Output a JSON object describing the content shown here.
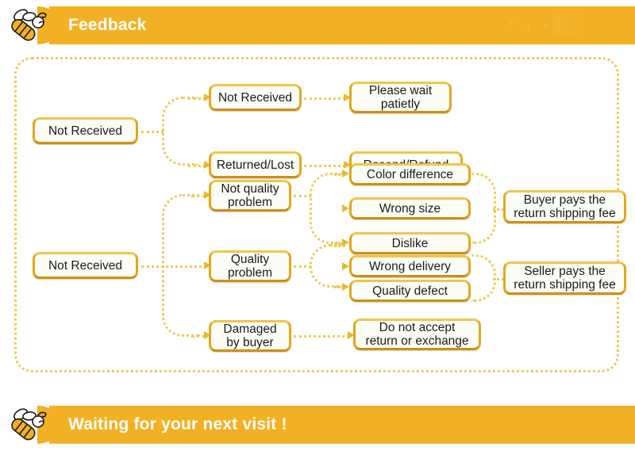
{
  "header": {
    "title": "Feedback",
    "icon": "bee-icon",
    "accent_color": "#f2b024",
    "title_color": "#ffffff"
  },
  "footer": {
    "title": "Waiting for your next visit !",
    "icon": "bee-icon",
    "accent_color": "#f2b024",
    "title_color": "#ffffff"
  },
  "theme": {
    "node_border": "#e3a71b",
    "node_fill": "#fdfdf7",
    "connector": "#eccb5a",
    "arrow": "#e8b932",
    "text": "#1a1a1a"
  },
  "flowchart": {
    "type": "diagram",
    "nodes": {
      "root_not_received_top": "Not Received",
      "root_not_received_bottom": "Not Received",
      "not_received_2": "Not Received",
      "returned_lost": "Returned/Lost",
      "please_wait": "Please wait\npatietly",
      "resend_refund": "Resend/Refund",
      "not_quality_problem": "Not quality\nproblem",
      "quality_problem": "Quality\nproblem",
      "damaged_by_buyer": "Damaged\nby buyer",
      "color_difference": "Color difference",
      "wrong_size": "Wrong size",
      "dislike": "Dislike",
      "wrong_delivery": "Wrong delivery",
      "quality_defect": "Quality defect",
      "buyer_pays": "Buyer pays the\nreturn shipping fee",
      "seller_pays": "Seller pays the\nreturn shipping fee",
      "do_not_accept": "Do not accept\nreturn or exchange"
    },
    "edges": [
      {
        "from": "root_not_received_top",
        "to": "not_received_2"
      },
      {
        "from": "root_not_received_top",
        "to": "returned_lost"
      },
      {
        "from": "not_received_2",
        "to": "please_wait"
      },
      {
        "from": "returned_lost",
        "to": "resend_refund"
      },
      {
        "from": "root_not_received_bottom",
        "to": "not_quality_problem"
      },
      {
        "from": "root_not_received_bottom",
        "to": "quality_problem"
      },
      {
        "from": "root_not_received_bottom",
        "to": "damaged_by_buyer"
      },
      {
        "from": "not_quality_problem",
        "to": "color_difference"
      },
      {
        "from": "not_quality_problem",
        "to": "wrong_size"
      },
      {
        "from": "not_quality_problem",
        "to": "dislike"
      },
      {
        "from": "quality_problem",
        "to": "wrong_delivery"
      },
      {
        "from": "quality_problem",
        "to": "quality_defect"
      },
      {
        "from": "color_difference",
        "to": "buyer_pays"
      },
      {
        "from": "wrong_size",
        "to": "buyer_pays"
      },
      {
        "from": "dislike",
        "to": "buyer_pays"
      },
      {
        "from": "wrong_delivery",
        "to": "seller_pays"
      },
      {
        "from": "quality_defect",
        "to": "seller_pays"
      },
      {
        "from": "damaged_by_buyer",
        "to": "do_not_accept"
      }
    ]
  }
}
